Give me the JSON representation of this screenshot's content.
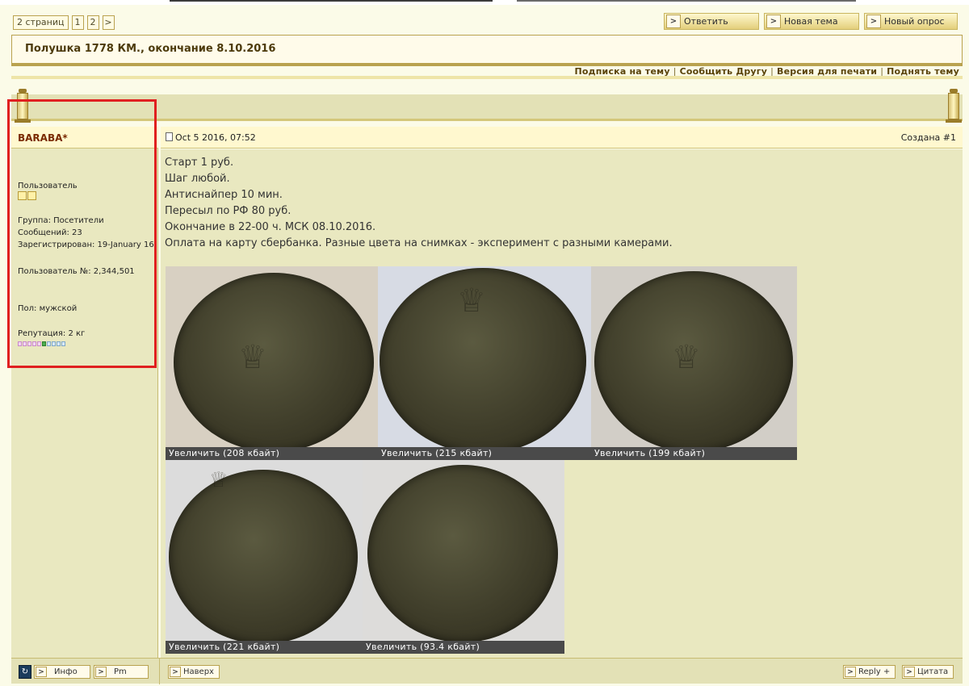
{
  "pager": {
    "pages_label": "2 страниц",
    "p1": "1",
    "p2": "2",
    "next": ">"
  },
  "buttons": {
    "reply": "Ответить",
    "new_topic": "Новая тема",
    "new_poll": "Новый опрос"
  },
  "topic": {
    "title": "Полушка 1778 КМ., окончание 8.10.2016"
  },
  "toplinks": [
    "Подписка на тему",
    "Сообщить Другу",
    "Версия для печати",
    "Поднять тему"
  ],
  "author": {
    "name": "BARABA*",
    "role": "Пользователь",
    "group": "Группа: Посетители",
    "posts": "Сообщений: 23",
    "registered": "Зарегистрирован: 19-January 16",
    "user_no": "Пользователь №: 2,344,501",
    "gender": "Пол: мужской",
    "reputation": "Репутация: 2 кг"
  },
  "post": {
    "date": "Oct 5 2016, 07:52",
    "number": "Создана #1",
    "lines": [
      "Старт 1 руб.",
      "Шаг любой.",
      "Антиснайпер 10 мин.",
      "Пересыл по РФ 80 руб.",
      "Окончание в 22-00 ч. МСК 08.10.2016.",
      "Оплата на карту сбербанка. Разные цвета на снимках - эксперимент с разными камерами."
    ],
    "images": [
      {
        "caption": "Увеличить (208 кбайт)"
      },
      {
        "caption": "Увеличить (215 кбайт)"
      },
      {
        "caption": "Увеличить (199 кбайт)"
      },
      {
        "caption": "Увеличить (221 кбайт)"
      },
      {
        "caption": "Увеличить (93.4 кбайт)"
      }
    ]
  },
  "footer": {
    "info": "Инфо",
    "pm": "Pm",
    "top": "Наверх",
    "reply_plus": "Reply +",
    "quote": "Цитата"
  },
  "colors": {
    "accent": "#b9a24f",
    "author_name": "#7a2a00",
    "highlight_box": "#e02020"
  }
}
